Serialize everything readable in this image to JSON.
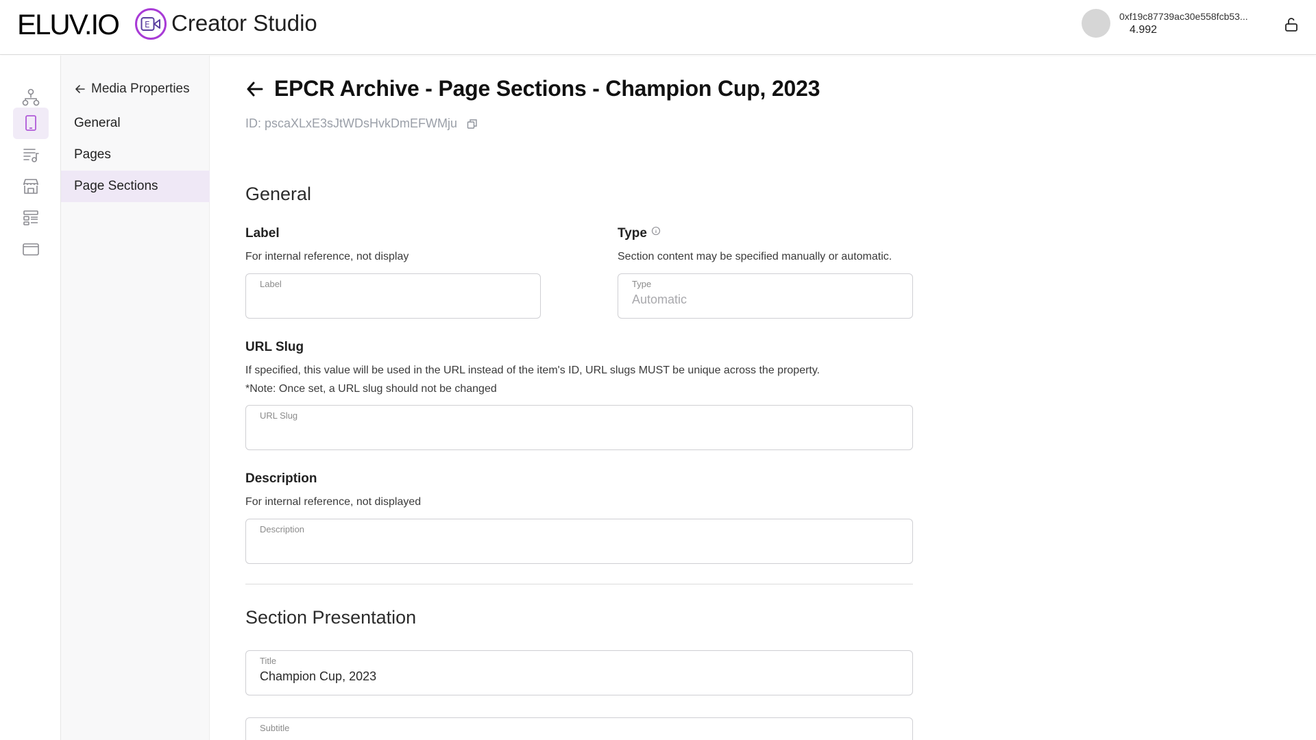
{
  "header": {
    "logo_text": "ELUV.IO",
    "app_title": "Creator Studio",
    "account_address": "0xf19c87739ac30e558fcb53...",
    "balance": "4.992"
  },
  "subnav": {
    "back_label": "Media Properties",
    "items": [
      {
        "label": "General"
      },
      {
        "label": "Pages"
      },
      {
        "label": "Page Sections"
      }
    ]
  },
  "page": {
    "title": "EPCR Archive - Page Sections - Champion Cup, 2023",
    "id_text": "ID: pscaXLxE3sJtWDsHvkDmEFWMju"
  },
  "general": {
    "heading": "General",
    "label_field": {
      "title": "Label",
      "description": "For internal reference, not display",
      "placeholder": "Label",
      "value": ""
    },
    "type_field": {
      "title": "Type",
      "description": "Section content may be specified manually or automatic.",
      "placeholder": "Type",
      "value": "Automatic"
    },
    "slug_field": {
      "title": "URL Slug",
      "description": "If specified, this value will be used in the URL instead of the item's ID, URL slugs MUST be unique across the property.",
      "note": "*Note: Once set, a URL slug should not be changed",
      "placeholder": "URL Slug",
      "value": ""
    },
    "description_field": {
      "title": "Description",
      "description": "For internal reference, not displayed",
      "placeholder": "Description",
      "value": ""
    }
  },
  "presentation": {
    "heading": "Section Presentation",
    "title_field": {
      "placeholder": "Title",
      "value": "Champion Cup, 2023"
    },
    "subtitle_field": {
      "placeholder": "Subtitle",
      "value": ""
    }
  },
  "colors": {
    "accent": "#a83bd6",
    "active_bg": "#efe8f6",
    "border": "#cfcfd3"
  }
}
